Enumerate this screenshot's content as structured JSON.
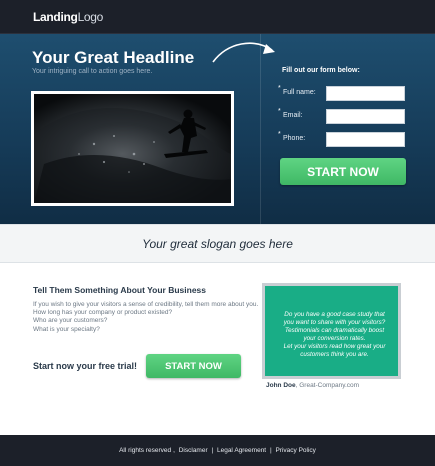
{
  "header": {
    "logo_bold": "Landing",
    "logo_light": "Logo"
  },
  "hero": {
    "headline": "Your Great Headline",
    "subheadline": "Your intriguing call to action goes here.",
    "form": {
      "title": "Fill out our form below:",
      "fields": [
        {
          "label": "Full name:",
          "value": ""
        },
        {
          "label": "Email:",
          "value": ""
        },
        {
          "label": "Phone:",
          "value": ""
        }
      ],
      "submit_label": "START NOW"
    }
  },
  "slogan": "Your great slogan goes here",
  "about": {
    "title": "Tell Them Something About Your Business",
    "lines": [
      "If you wish to give your visitors a sense of credibility, tell them more about you.",
      "How long has your company or product existed?",
      "Who are your customers?",
      "What is your specialty?"
    ],
    "trial_text": "Start now your free trial!",
    "trial_button": "START NOW"
  },
  "testimonial": {
    "lines": [
      "Do you have a good case study that",
      "you want to share with your visitors?",
      "Testimonials can dramatically boost",
      "your conversion rates.",
      "Let your visitors read how great your",
      "customers think you are."
    ],
    "author": "John Doe",
    "company": ", Great-Company.com"
  },
  "footer": {
    "links": [
      "All rights reserved",
      "Disclamer",
      "Legal Agreement",
      "Privacy Policy"
    ],
    "separators": [
      ",",
      "|",
      "|"
    ]
  },
  "colors": {
    "accent_green": "#4cc471",
    "testimonial_bg": "#19ad86",
    "hero_blue": "#1e4e6f"
  }
}
